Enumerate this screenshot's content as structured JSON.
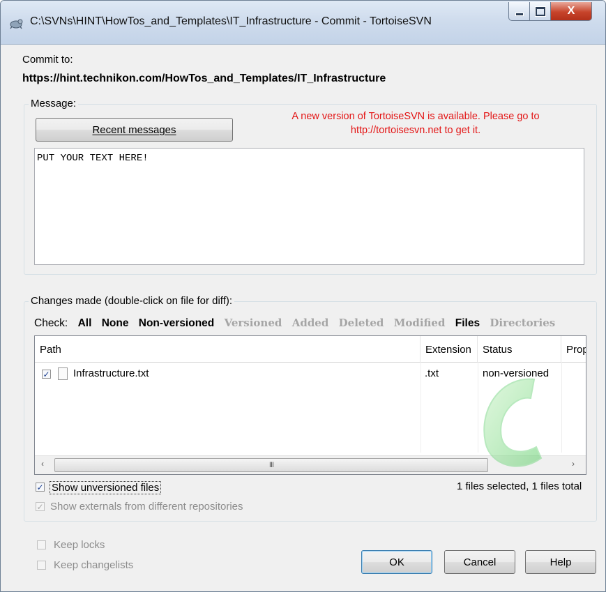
{
  "window": {
    "title": "C:\\SVNs\\HINT\\HowTos_and_Templates\\IT_Infrastructure - Commit - TortoiseSVN",
    "icon": "tortoisesvn-icon",
    "controls": {
      "minimize_icon": "minimize-icon",
      "maximize_icon": "maximize-icon",
      "close_glyph": "X"
    }
  },
  "commit": {
    "label": "Commit to:",
    "url": "https://hint.technikon.com/HowTos_and_Templates/IT_Infrastructure"
  },
  "message_group": {
    "legend": "Message:",
    "recent_button": "Recent messages",
    "update_notice_line1": "A new version of TortoiseSVN is available. Please go to",
    "update_notice_line2": "http://tortoisesvn.net to get it.",
    "update_notice_color": "#e31414",
    "message_text": "PUT YOUR TEXT HERE!"
  },
  "changes_group": {
    "legend": "Changes made (double-click on file for diff):",
    "check_label": "Check:",
    "filters_active": [
      "All",
      "None",
      "Non-versioned"
    ],
    "filters_inactive": [
      "Versioned",
      "Added",
      "Deleted",
      "Modified"
    ],
    "filter_files": "Files",
    "filter_directories": "Directories",
    "columns": [
      "Path",
      "Extension",
      "Status",
      "Prop"
    ],
    "rows": [
      {
        "checked": true,
        "path": "Infrastructure.txt",
        "extension": ".txt",
        "status": "non-versioned"
      }
    ],
    "scroll_left": "‹",
    "scroll_thumb": "III",
    "scroll_right": "›",
    "show_unversioned": {
      "label": "Show unversioned files",
      "checked": true
    },
    "show_externals": {
      "label": "Show externals from different repositories",
      "checked": true,
      "enabled": false
    },
    "selection_status": "1 files selected, 1 files total"
  },
  "options": {
    "keep_locks": {
      "label": "Keep locks",
      "checked": false,
      "enabled": false
    },
    "keep_changelists": {
      "label": "Keep changelists",
      "checked": false,
      "enabled": false
    }
  },
  "buttons": {
    "ok": "OK",
    "cancel": "Cancel",
    "help": "Help"
  }
}
